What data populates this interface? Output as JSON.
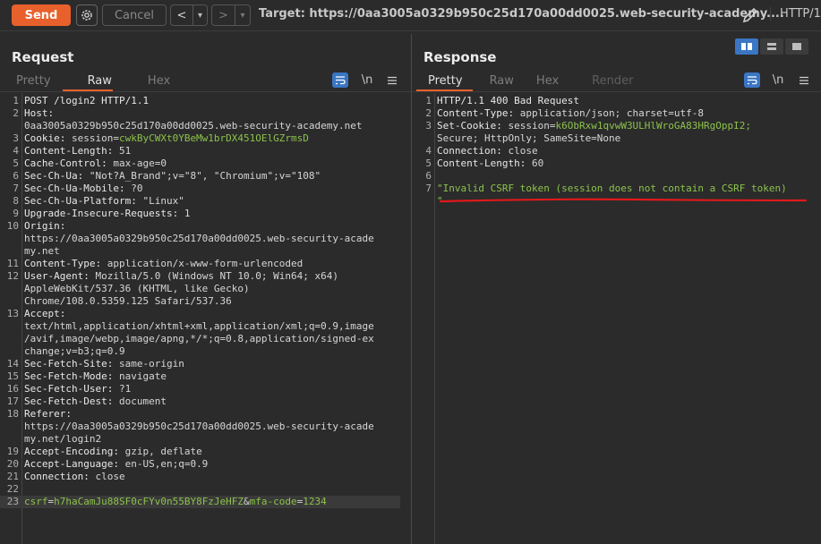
{
  "toolbar": {
    "send_label": "Send",
    "cancel_label": "Cancel",
    "back_label": "<",
    "back_dropdown": "▾",
    "forward_label": ">",
    "forward_dropdown": "▾",
    "target_text": "Target: https://0aa3005a0329b950c25d170a00dd0025.web-security-academy....",
    "http_version": "HTTP/1"
  },
  "request": {
    "title": "Request",
    "tabs": [
      "Pretty",
      "Raw",
      "Hex"
    ],
    "active_tab": "Raw",
    "wrap_icon": "wrap-lines-icon",
    "newline_label": "\\n",
    "menu_icon": "menu-icon",
    "lines": [
      {
        "n": "1",
        "name": "POST /login2 HTTP/1.1",
        "value": ""
      },
      {
        "n": "2",
        "name": "Host:",
        "value": ""
      },
      {
        "n": "",
        "name": "",
        "value": "0aa3005a0329b950c25d170a00dd0025.web-security-academy.net"
      },
      {
        "n": "3",
        "name": "Cookie: ",
        "value": "session=",
        "green": "cwkByCWXt0YBeMw1brDX451OElGZrmsD"
      },
      {
        "n": "4",
        "name": "Content-Length: ",
        "value": "51"
      },
      {
        "n": "5",
        "name": "Cache-Control: ",
        "value": "max-age=0"
      },
      {
        "n": "6",
        "name": "Sec-Ch-Ua: ",
        "value": "\"Not?A_Brand\";v=\"8\", \"Chromium\";v=\"108\""
      },
      {
        "n": "7",
        "name": "Sec-Ch-Ua-Mobile: ",
        "value": "?0"
      },
      {
        "n": "8",
        "name": "Sec-Ch-Ua-Platform: ",
        "value": "\"Linux\""
      },
      {
        "n": "9",
        "name": "Upgrade-Insecure-Requests: ",
        "value": "1"
      },
      {
        "n": "10",
        "name": "Origin:",
        "value": ""
      },
      {
        "n": "",
        "name": "",
        "value": "https://0aa3005a0329b950c25d170a00dd0025.web-security-acade"
      },
      {
        "n": "",
        "name": "",
        "value": "my.net"
      },
      {
        "n": "11",
        "name": "Content-Type: ",
        "value": "application/x-www-form-urlencoded"
      },
      {
        "n": "12",
        "name": "User-Agent: ",
        "value": "Mozilla/5.0 (Windows NT 10.0; Win64; x64)"
      },
      {
        "n": "",
        "name": "",
        "value": "AppleWebKit/537.36 (KHTML, like Gecko)"
      },
      {
        "n": "",
        "name": "",
        "value": "Chrome/108.0.5359.125 Safari/537.36"
      },
      {
        "n": "13",
        "name": "Accept:",
        "value": ""
      },
      {
        "n": "",
        "name": "",
        "value": "text/html,application/xhtml+xml,application/xml;q=0.9,image"
      },
      {
        "n": "",
        "name": "",
        "value": "/avif,image/webp,image/apng,*/*;q=0.8,application/signed-ex"
      },
      {
        "n": "",
        "name": "",
        "value": "change;v=b3;q=0.9"
      },
      {
        "n": "14",
        "name": "Sec-Fetch-Site: ",
        "value": "same-origin"
      },
      {
        "n": "15",
        "name": "Sec-Fetch-Mode: ",
        "value": "navigate"
      },
      {
        "n": "16",
        "name": "Sec-Fetch-User: ",
        "value": "?1"
      },
      {
        "n": "17",
        "name": "Sec-Fetch-Dest: ",
        "value": "document"
      },
      {
        "n": "18",
        "name": "Referer:",
        "value": ""
      },
      {
        "n": "",
        "name": "",
        "value": "https://0aa3005a0329b950c25d170a00dd0025.web-security-acade"
      },
      {
        "n": "",
        "name": "",
        "value": "my.net/login2"
      },
      {
        "n": "19",
        "name": "Accept-Encoding: ",
        "value": "gzip, deflate"
      },
      {
        "n": "20",
        "name": "Accept-Language: ",
        "value": "en-US,en;q=0.9"
      },
      {
        "n": "21",
        "name": "Connection: ",
        "value": "close"
      },
      {
        "n": "22",
        "name": "",
        "value": ""
      },
      {
        "n": "23",
        "name": "",
        "value": "",
        "body": true,
        "p1": "csrf",
        "v1": "h7haCamJu88SF0cFYv0n55BY8FzJeHFZ",
        "p2": "mfa-code",
        "v2": "1234"
      }
    ]
  },
  "response": {
    "title": "Response",
    "tabs": [
      "Pretty",
      "Raw",
      "Hex",
      "Render"
    ],
    "active_tab": "Pretty",
    "wrap_icon": "wrap-lines-icon",
    "newline_label": "\\n",
    "menu_icon": "menu-icon",
    "lines": [
      {
        "n": "1",
        "name": "HTTP/1.1 400 Bad Request",
        "value": ""
      },
      {
        "n": "2",
        "name": "Content-Type: ",
        "value": "application/json; charset=utf-8"
      },
      {
        "n": "3",
        "name": "Set-Cookie: ",
        "value": "session=",
        "green": "k6ObRxw1qvwW3ULHlWroGA83HRgOppI2;"
      },
      {
        "n": "",
        "name": "",
        "value": "Secure; HttpOnly; SameSite=None"
      },
      {
        "n": "4",
        "name": "Connection: ",
        "value": "close"
      },
      {
        "n": "5",
        "name": "Content-Length: ",
        "value": "60"
      },
      {
        "n": "6",
        "name": "",
        "value": ""
      },
      {
        "n": "7",
        "name": "",
        "value": "",
        "green": "\"Invalid CSRF token (session does not contain a CSRF token)"
      },
      {
        "n": "",
        "name": "",
        "value": "",
        "green": "\""
      }
    ]
  },
  "layout_icons": [
    "split-horizontal-icon",
    "split-vertical-icon",
    "single-pane-icon"
  ],
  "colors": {
    "accent": "#e8612c",
    "highlight_green": "#8cc24a",
    "annotation_red": "#e0191b",
    "active_blue": "#3a76c4"
  }
}
